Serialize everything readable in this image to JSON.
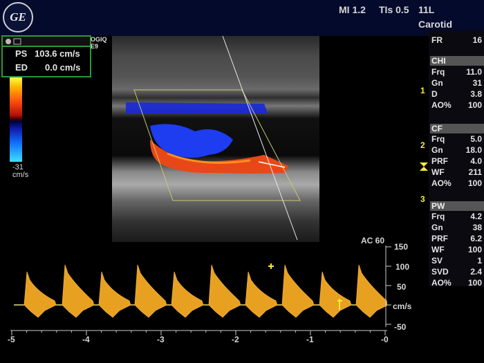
{
  "header": {
    "logo_text": "GE",
    "mi": "MI 1.2",
    "tis": "TIs 0.5",
    "probe": "11L",
    "preset": "Carotid"
  },
  "measurements": {
    "ps_label": "PS",
    "ps_value": "103.6 cm/s",
    "ed_label": "ED",
    "ed_value": "0.0 cm/s"
  },
  "device_label": {
    "line1": "OGIQ",
    "line2": "E9"
  },
  "color_bar": {
    "value": "-31",
    "unit": "cm/s"
  },
  "params": {
    "fr": {
      "label": "FR",
      "value": "16"
    },
    "chi": {
      "title": "CHI",
      "rows": [
        {
          "label": "Frq",
          "value": "11.0"
        },
        {
          "label": "Gn",
          "value": "31"
        },
        {
          "label": "D",
          "value": "3.8"
        },
        {
          "label": "AO%",
          "value": "100"
        }
      ]
    },
    "cf": {
      "title": "CF",
      "rows": [
        {
          "label": "Frq",
          "value": "5.0"
        },
        {
          "label": "Gn",
          "value": "18.0"
        },
        {
          "label": "PRF",
          "value": "4.0"
        },
        {
          "label": "WF",
          "value": "211"
        },
        {
          "label": "AO%",
          "value": "100"
        }
      ]
    },
    "pw": {
      "title": "PW",
      "rows": [
        {
          "label": "Frq",
          "value": "4.2"
        },
        {
          "label": "Gn",
          "value": "38"
        },
        {
          "label": "PRF",
          "value": "6.2"
        },
        {
          "label": "WF",
          "value": "100"
        },
        {
          "label": "SV",
          "value": "1"
        },
        {
          "label": "SVD",
          "value": "2.4"
        },
        {
          "label": "AO%",
          "value": "100"
        }
      ]
    }
  },
  "depth_marks": [
    "1",
    "2",
    "3"
  ],
  "spectral": {
    "ac_label": "AC 60",
    "velocity_scale": [
      "150",
      "100",
      "50",
      "cm/s",
      "-50"
    ],
    "time_scale": [
      "-5",
      "-4",
      "-3",
      "-2",
      "-1",
      "-0"
    ]
  },
  "colors": {
    "doppler_trace": "#e8a020",
    "measure_box": "#2a9a3a",
    "accent_yellow": "#ffeb3b"
  }
}
